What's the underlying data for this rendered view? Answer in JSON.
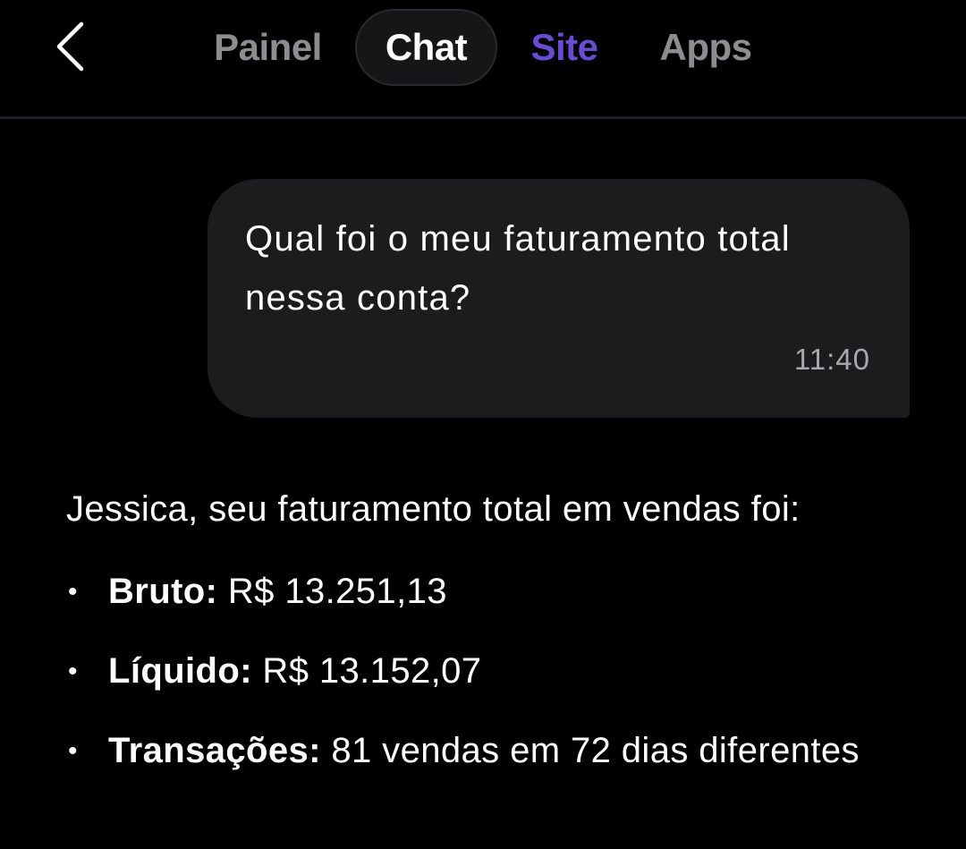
{
  "header": {
    "back_icon": "chevron-left-icon",
    "tabs": [
      {
        "label": "Painel",
        "state": "inactive",
        "color": "#8d8d91"
      },
      {
        "label": "Chat",
        "state": "active",
        "color": "#ffffff"
      },
      {
        "label": "Site",
        "state": "highlight",
        "color": "#6a4bd4"
      },
      {
        "label": "Apps",
        "state": "inactive",
        "color": "#8d8d91"
      }
    ]
  },
  "chat": {
    "user_message": {
      "text": "Qual foi o meu faturamento total nessa conta?",
      "time": "11:40"
    },
    "reply": {
      "intro": "Jessica, seu faturamento total em vendas foi:",
      "items": [
        {
          "label": "Bruto:",
          "value": " R$ 13.251,13"
        },
        {
          "label": "Líquido:",
          "value": " R$ 13.152,07"
        },
        {
          "label": "Transações:",
          "value": " 81 vendas em 72 dias diferentes"
        }
      ]
    }
  },
  "colors": {
    "background": "#000000",
    "bubble": "#1c1c1e",
    "accent": "#6a4bd4"
  }
}
